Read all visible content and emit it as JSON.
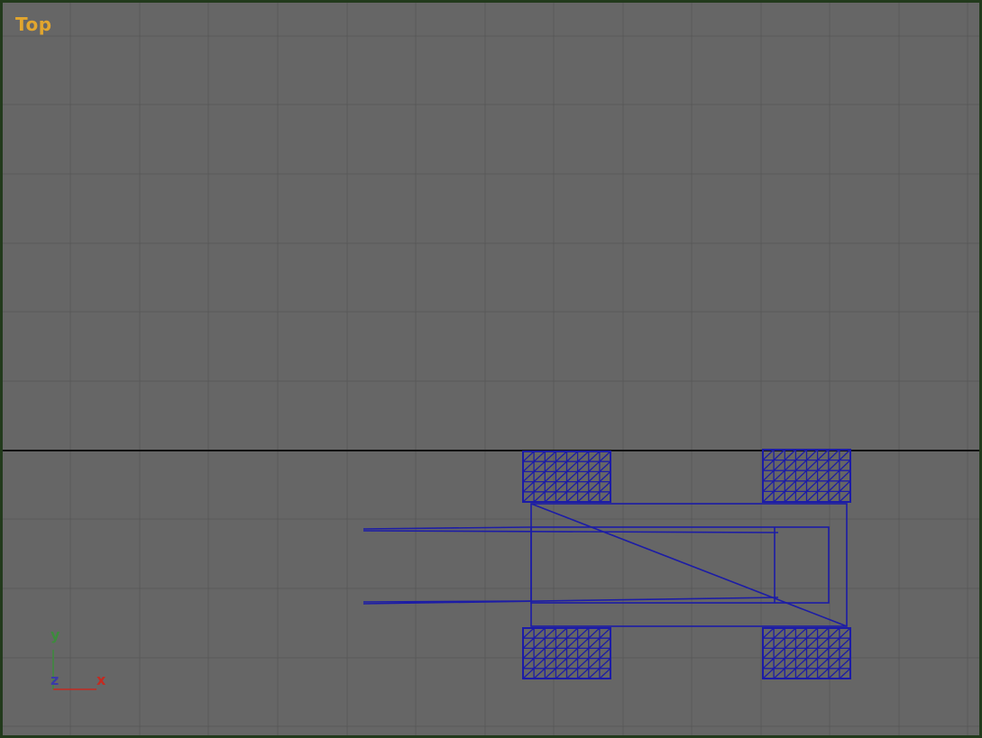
{
  "viewport": {
    "label": "Top",
    "colors": {
      "background": "#666666",
      "grid": "#595959",
      "home_grid": "#111111",
      "wireframe": "#1c1ca6",
      "label": "#e2a62e",
      "border": "#223a1c"
    }
  },
  "axis_tripod": {
    "y_label": "y",
    "z_label": "z",
    "x_label": "x",
    "colors": {
      "x": "#c42a20",
      "y": "#3c8c3c",
      "z": "#3a3aa8"
    }
  }
}
